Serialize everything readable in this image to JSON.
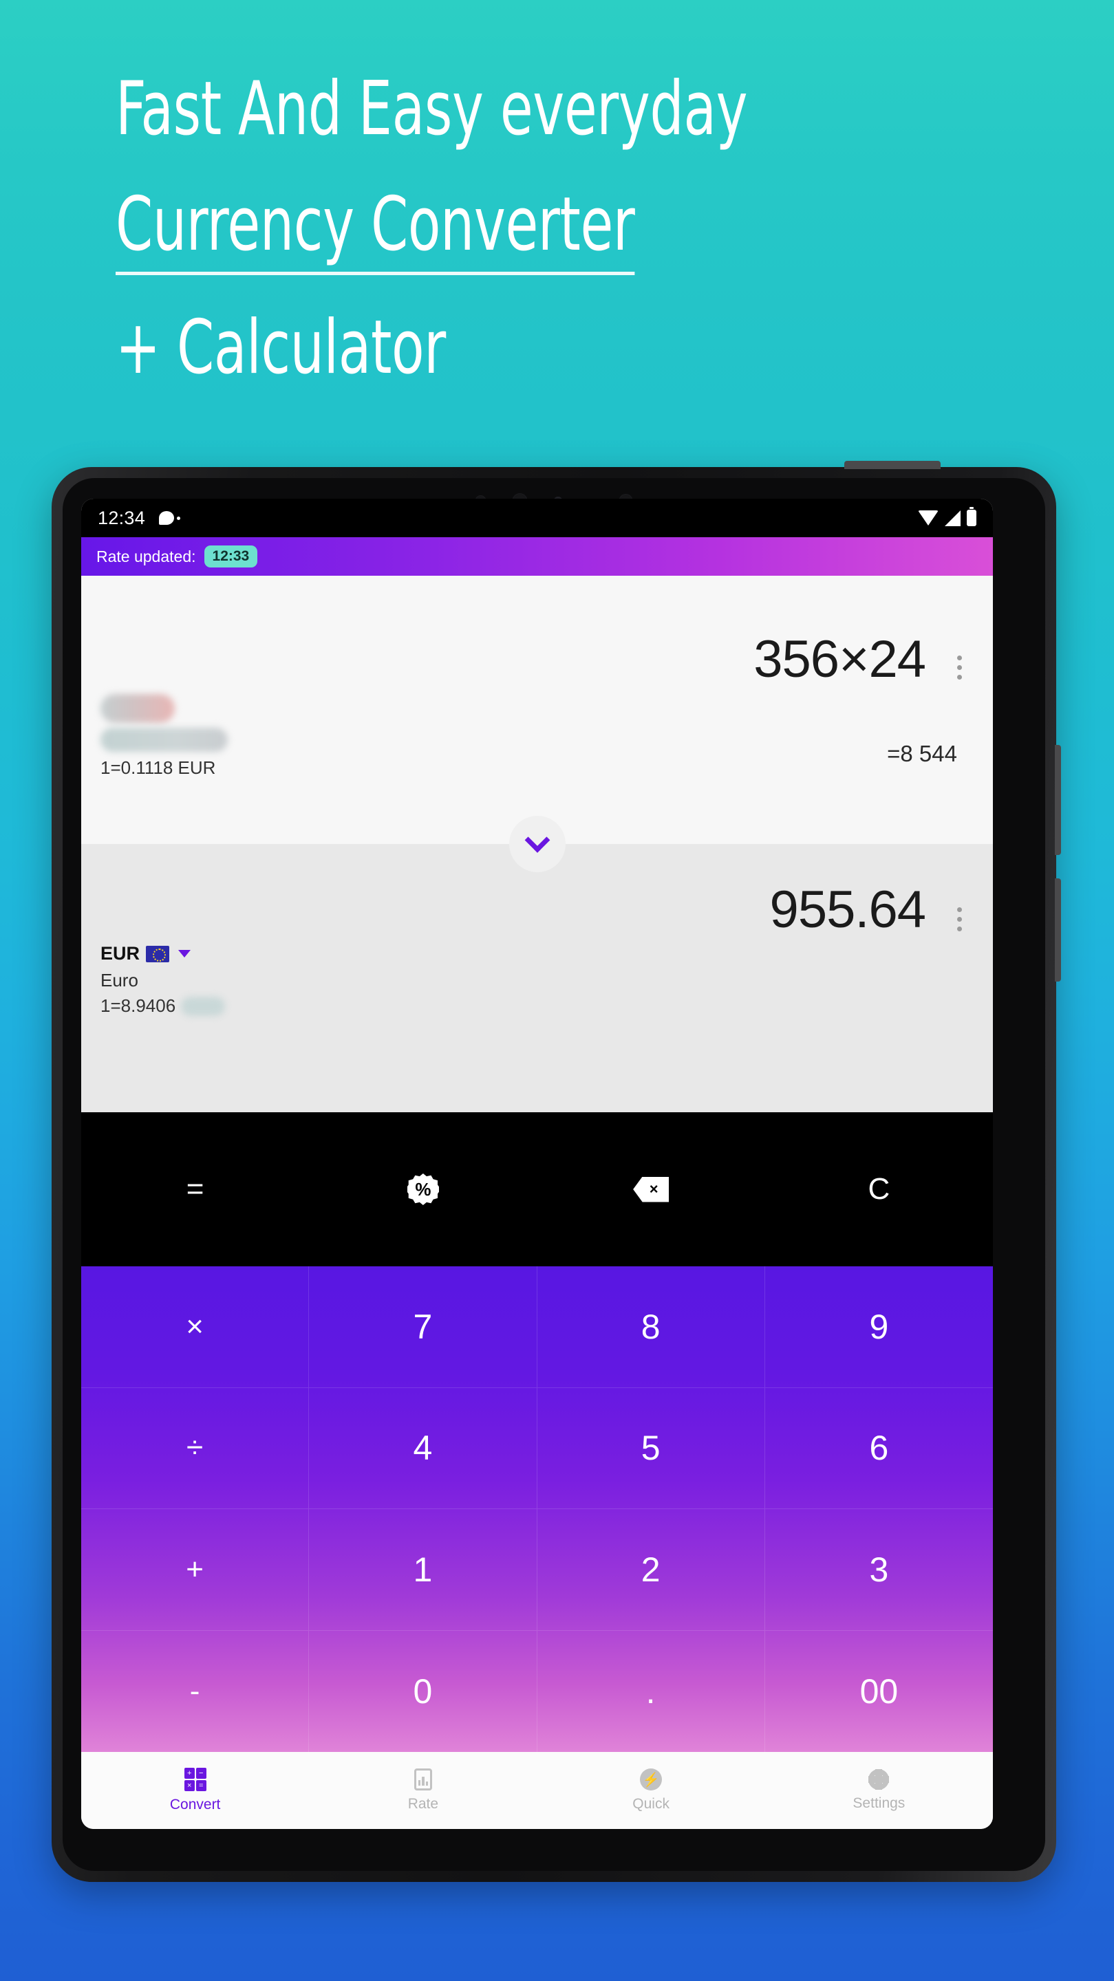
{
  "promo": {
    "line1": "Fast And Easy everyday",
    "line2": "Currency Converter",
    "line3": "+ Calculator"
  },
  "statusbar": {
    "time": "12:34",
    "icons": [
      "notification-bubble-icon",
      "wifi-icon",
      "signal-icon",
      "battery-icon"
    ]
  },
  "rate_banner": {
    "label": "Rate updated:",
    "time_badge": "12:33",
    "badge_color": "#6de0cf"
  },
  "converter": {
    "from": {
      "code_hidden": true,
      "name_hidden": true,
      "rate_line": "1=0.1118 EUR",
      "expression": "356×24",
      "result": "=8 544",
      "menu_icon": "kebab-menu-icon"
    },
    "swap_icon": "chevron-down-icon",
    "to": {
      "code": "EUR",
      "flag": "eu-flag-icon",
      "dropdown_icon": "caret-down-icon",
      "name": "Euro",
      "rate_prefix": "1=8.9406",
      "rate_suffix_hidden": true,
      "amount": "955.64",
      "menu_icon": "kebab-menu-icon"
    }
  },
  "function_bar": [
    {
      "name": "equals-button",
      "label": "=",
      "icon": "equals-icon"
    },
    {
      "name": "percent-button",
      "label": "%",
      "icon": "percent-badge-icon"
    },
    {
      "name": "backspace-button",
      "label": "×",
      "icon": "backspace-icon"
    },
    {
      "name": "clear-button",
      "label": "C",
      "icon": "clear-icon"
    }
  ],
  "keypad": {
    "rows": [
      [
        "×",
        "7",
        "8",
        "9"
      ],
      [
        "÷",
        "4",
        "5",
        "6"
      ],
      [
        "+",
        "1",
        "2",
        "3"
      ],
      [
        "-",
        "0",
        ".",
        "00"
      ]
    ]
  },
  "bottom_nav": {
    "active": "Convert",
    "items": [
      {
        "label": "Convert",
        "icon": "calculator-grid-icon"
      },
      {
        "label": "Rate",
        "icon": "chart-bars-icon"
      },
      {
        "label": "Quick",
        "icon": "bolt-circle-icon"
      },
      {
        "label": "Settings",
        "icon": "gear-icon"
      }
    ]
  },
  "colors": {
    "accent_purple": "#6a16e0",
    "banner_start": "#6717e8",
    "banner_end": "#d94fd8",
    "badge_teal": "#6de0cf",
    "bg_top": "#2ccfc4",
    "bg_bottom": "#1f5fd3"
  }
}
